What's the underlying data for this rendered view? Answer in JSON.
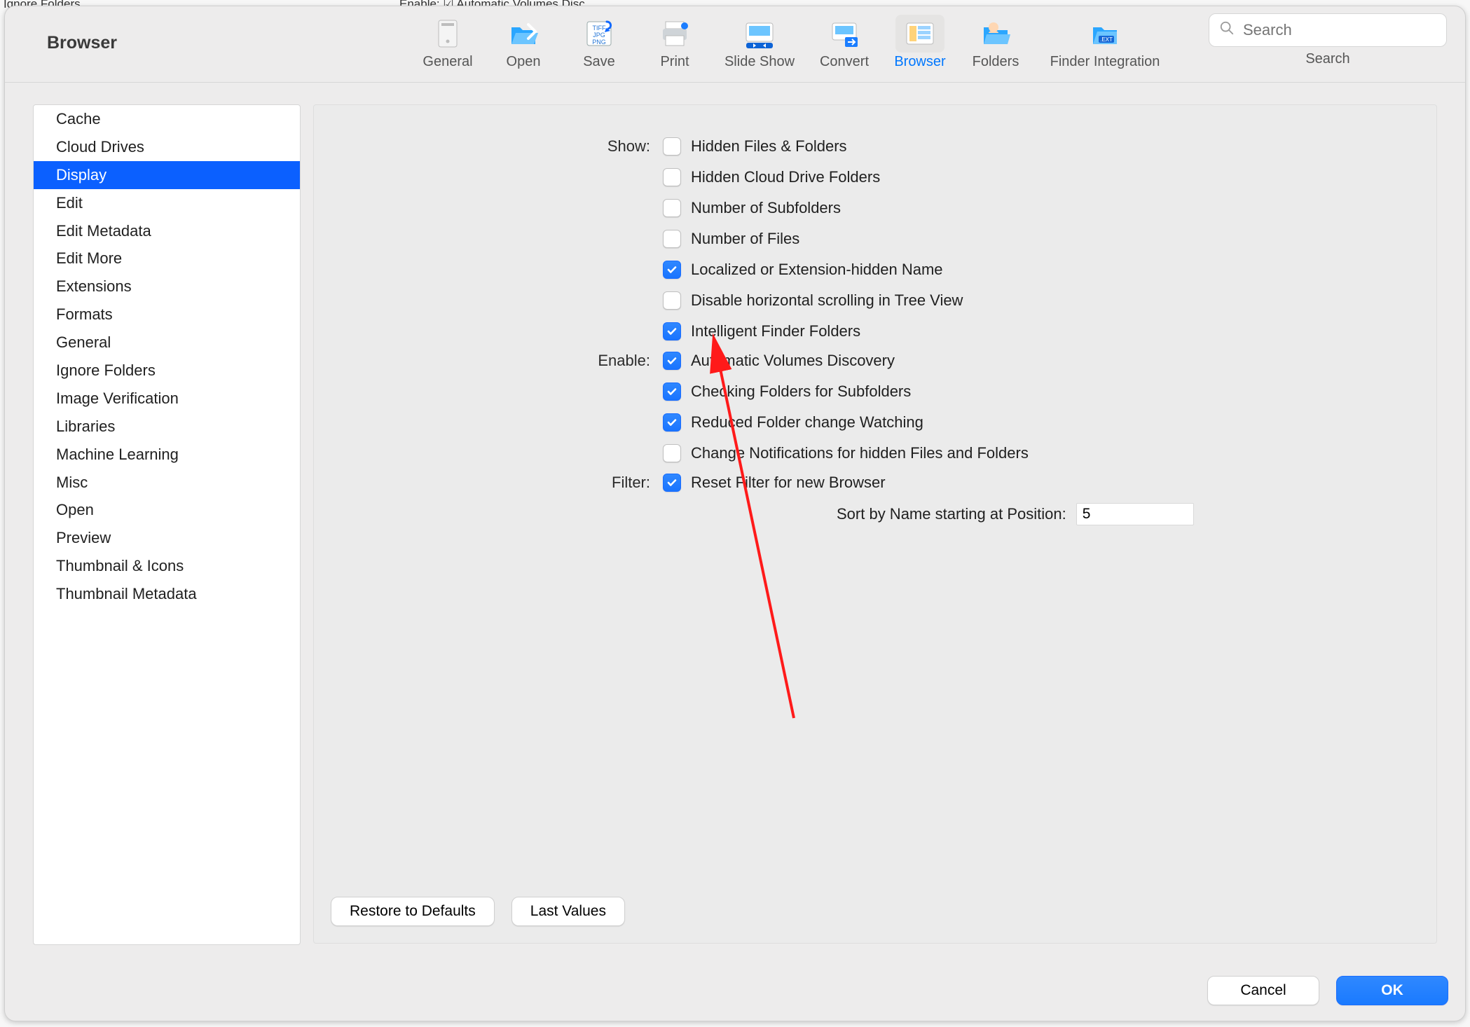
{
  "bg_phantom": {
    "left": "Ignore Folders",
    "right": "Enable: ☑  Automatic Volumes Disc…"
  },
  "title": "Browser",
  "toolbar": {
    "items": [
      {
        "key": "general",
        "label": "General"
      },
      {
        "key": "open",
        "label": "Open"
      },
      {
        "key": "save",
        "label": "Save"
      },
      {
        "key": "print",
        "label": "Print"
      },
      {
        "key": "slide-show",
        "label": "Slide Show"
      },
      {
        "key": "convert",
        "label": "Convert"
      },
      {
        "key": "browser",
        "label": "Browser"
      },
      {
        "key": "folders",
        "label": "Folders"
      },
      {
        "key": "finder-integration",
        "label": "Finder Integration"
      }
    ],
    "active": "browser",
    "search_placeholder": "Search",
    "search_caption": "Search"
  },
  "sidebar": {
    "items": [
      "Cache",
      "Cloud Drives",
      "Display",
      "Edit",
      "Edit Metadata",
      "Edit More",
      "Extensions",
      "Formats",
      "General",
      "Ignore Folders",
      "Image Verification",
      "Libraries",
      "Machine Learning",
      "Misc",
      "Open",
      "Preview",
      "Thumbnail & Icons",
      "Thumbnail Metadata"
    ],
    "selected": "Display"
  },
  "form": {
    "groups": [
      {
        "label": "Show:",
        "options": [
          {
            "text": "Hidden Files & Folders",
            "checked": false
          },
          {
            "text": "Hidden Cloud Drive Folders",
            "checked": false
          },
          {
            "text": "Number of Subfolders",
            "checked": false
          },
          {
            "text": "Number of Files",
            "checked": false
          },
          {
            "text": "Localized or Extension-hidden Name",
            "checked": true
          },
          {
            "text": "Disable horizontal scrolling in Tree View",
            "checked": false
          },
          {
            "text": "Intelligent Finder Folders",
            "checked": true
          }
        ]
      },
      {
        "label": "Enable:",
        "options": [
          {
            "text": "Automatic Volumes Discovery",
            "checked": true
          },
          {
            "text": "Checking Folders for Subfolders",
            "checked": true
          },
          {
            "text": "Reduced Folder change Watching",
            "checked": true
          },
          {
            "text": "Change Notifications for hidden Files and Folders",
            "checked": false
          }
        ]
      },
      {
        "label": "Filter:",
        "options": [
          {
            "text": "Reset Filter for new Browser",
            "checked": true
          }
        ]
      }
    ],
    "sort_label": "Sort by Name starting at Position:",
    "sort_value": "5"
  },
  "buttons": {
    "restore": "Restore to Defaults",
    "last": "Last Values",
    "cancel": "Cancel",
    "ok": "OK"
  }
}
